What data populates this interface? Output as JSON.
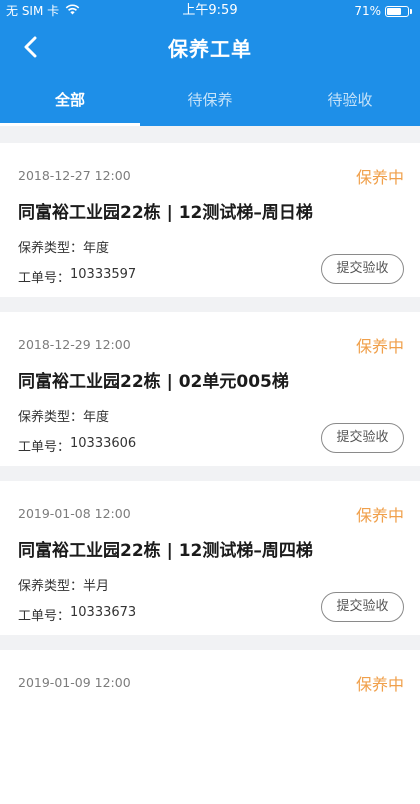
{
  "status_bar": {
    "carrier": "无 SIM 卡",
    "wifi_icon": "wifi-icon",
    "time": "上午9:59",
    "battery_percent": "71%",
    "battery_level": 0.71
  },
  "nav": {
    "back_icon": "chevron-left-icon",
    "title": "保养工单"
  },
  "tabs": [
    {
      "label": "全部",
      "active": true
    },
    {
      "label": "待保养",
      "active": false
    },
    {
      "label": "待验收",
      "active": false
    }
  ],
  "labels": {
    "type_label": "保养类型：",
    "order_label": "工单号：",
    "submit_button": "提交验收"
  },
  "colors": {
    "header_bg": "#1e8fe8",
    "status_orange": "#f0a04b",
    "page_bg": "#f1f2f4"
  },
  "work_orders": [
    {
      "date": "2018-12-27 12:00",
      "status": "保养中",
      "title": "同富裕工业园22栋 | 12测试梯–周日梯",
      "type": "年度",
      "order_no": "10333597"
    },
    {
      "date": "2018-12-29 12:00",
      "status": "保养中",
      "title": "同富裕工业园22栋 | 02单元005梯",
      "type": "年度",
      "order_no": "10333606"
    },
    {
      "date": "2019-01-08 12:00",
      "status": "保养中",
      "title": "同富裕工业园22栋 | 12测试梯–周四梯",
      "type": "半月",
      "order_no": "10333673"
    },
    {
      "date": "2019-01-09 12:00",
      "status": "保养中"
    }
  ]
}
